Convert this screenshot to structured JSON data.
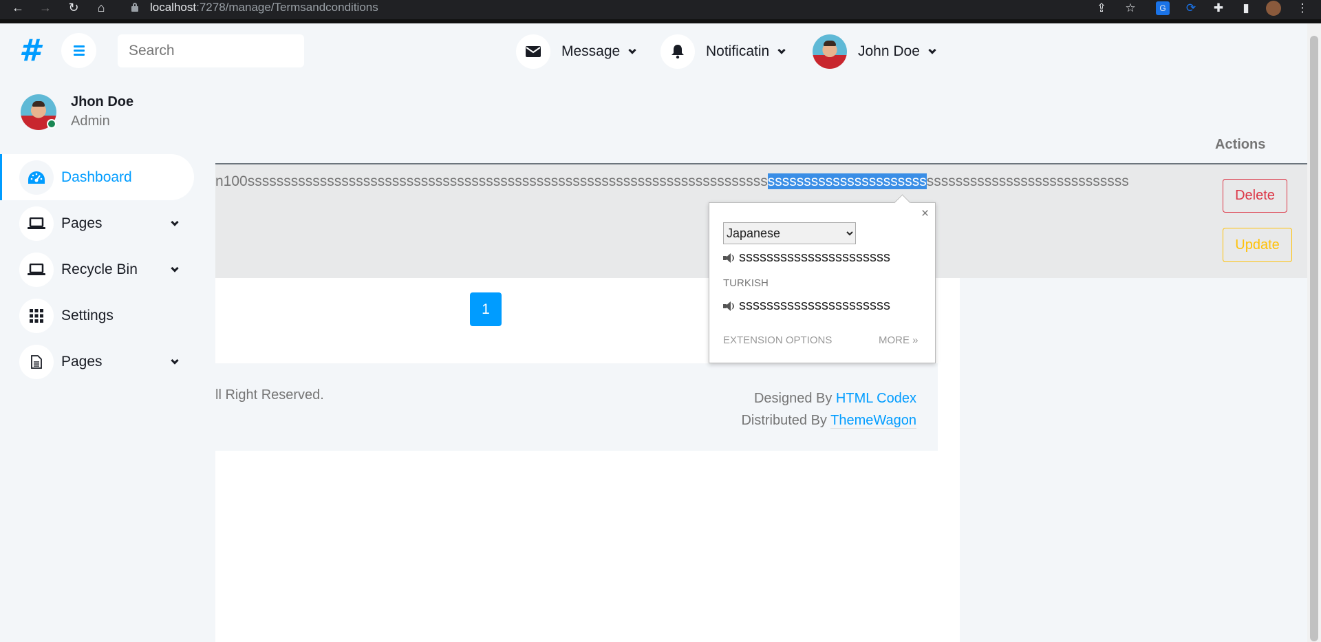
{
  "browser": {
    "url_host": "localhost",
    "url_path": ":7278/manage/Termsandconditions"
  },
  "header": {
    "logo": "#",
    "search_placeholder": "Search",
    "message_label": "Message",
    "notification_label": "Notificatin",
    "user_label": "John Doe"
  },
  "sidebar": {
    "profile_name": "Jhon Doe",
    "profile_role": "Admin",
    "items": [
      {
        "label": "Dashboard"
      },
      {
        "label": "Pages"
      },
      {
        "label": "Recycle Bin"
      },
      {
        "label": "Settings"
      },
      {
        "label": "Pages"
      }
    ]
  },
  "table": {
    "actions_header": "Actions",
    "row_text_before": "n100ssssssssssssssssssssssssssssssssssssssssssssssssssssssssssssssssssssssss",
    "row_text_selected": "ssssssssssssssssssssss",
    "row_text_after": "ssssssssssssssssssssssssssss",
    "delete_label": "Delete",
    "update_label": "Update"
  },
  "pagination": {
    "current_page": "1"
  },
  "footer": {
    "left_text": "ll Right Reserved.",
    "designed_by": "Designed By ",
    "designed_link": "HTML Codex",
    "distributed_by": "Distributed By ",
    "distributed_link": "ThemeWagon"
  },
  "translate_popup": {
    "close": "×",
    "selected_language": "Japanese",
    "translation": "ssssssssssssssssssssss",
    "detected_language": "TURKISH",
    "original": "ssssssssssssssssssssss",
    "extension_options": "EXTENSION OPTIONS",
    "more": "MORE »"
  },
  "colors": {
    "primary": "#009cff",
    "danger": "#dc3545",
    "warning": "#ffc107",
    "background": "#f3f6f9"
  }
}
